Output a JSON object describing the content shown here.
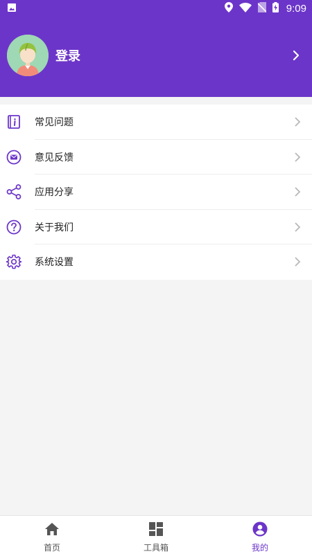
{
  "status_bar": {
    "time": "9:09",
    "icons": [
      "image-icon",
      "location-icon",
      "wifi-icon",
      "no-sim-icon",
      "battery-charging-icon"
    ]
  },
  "header": {
    "login_label": "登录",
    "avatar_icon": "avatar-icon",
    "arrow_icon": "chevron-right-icon"
  },
  "menu": {
    "items": [
      {
        "label": "常见问题",
        "icon": "faq-book-icon"
      },
      {
        "label": "意见反馈",
        "icon": "feedback-mail-icon"
      },
      {
        "label": "应用分享",
        "icon": "share-icon"
      },
      {
        "label": "关于我们",
        "icon": "question-circle-icon"
      },
      {
        "label": "系统设置",
        "icon": "gear-icon"
      }
    ]
  },
  "bottom_nav": {
    "items": [
      {
        "label": "首页",
        "icon": "home-icon",
        "active": false
      },
      {
        "label": "工具箱",
        "icon": "toolbox-grid-icon",
        "active": false
      },
      {
        "label": "我的",
        "icon": "profile-icon",
        "active": true
      }
    ]
  },
  "colors": {
    "accent": "#6c35c9",
    "background": "#f4f4f4",
    "nav_inactive": "#555555"
  }
}
